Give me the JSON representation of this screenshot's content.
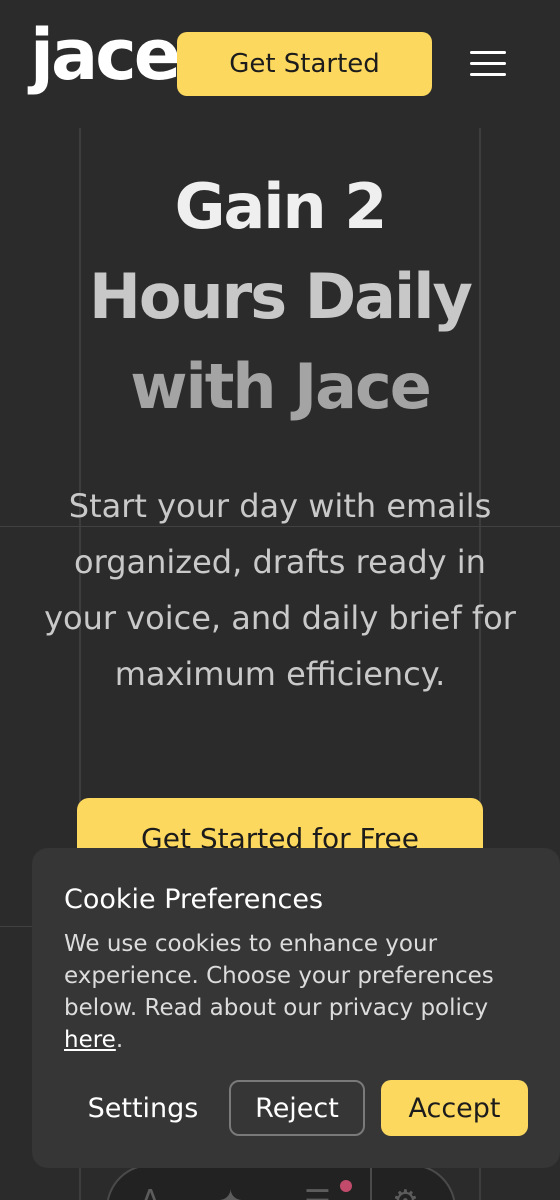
{
  "header": {
    "logo": "jace",
    "cta_label": "Get Started",
    "menu_icon": "hamburger-menu-icon"
  },
  "hero": {
    "title_line1": "Gain 2",
    "title_line2": "Hours Daily",
    "title_line3": "with Jace",
    "subtitle": "Start your day with emails organized, drafts ready in your voice, and daily brief for maximum efficiency.",
    "cta_label": "Get Started for Free"
  },
  "cookie_banner": {
    "title": "Cookie Preferences",
    "text": "We use cookies to enhance your experience. Choose your preferences below. Read about our privacy policy ",
    "link_text": "here",
    "text_end": ".",
    "settings_label": "Settings",
    "reject_label": "Reject",
    "accept_label": "Accept"
  },
  "toolbar": {
    "icons": [
      "text-format-icon",
      "magic-wand-icon",
      "align-icon",
      "settings-gear-icon"
    ]
  },
  "colors": {
    "background": "#2b2b2b",
    "accent": "#fdd85e",
    "panel": "#363636"
  }
}
